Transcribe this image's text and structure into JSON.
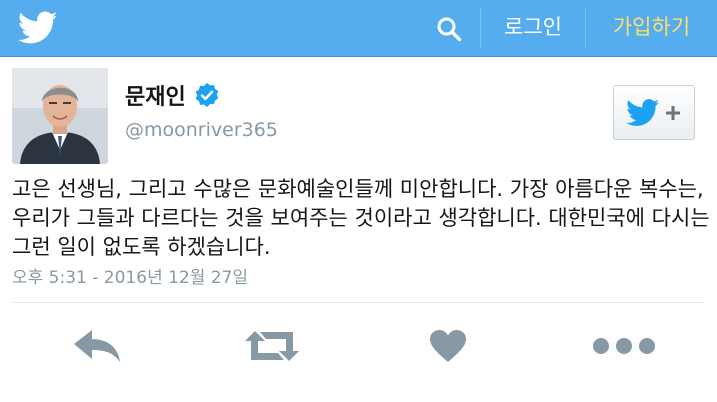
{
  "header": {
    "search_icon": "search-icon",
    "login_label": "로그인",
    "signup_label": "가입하기",
    "colors": {
      "bar": "#55acee",
      "signup": "#ffe066"
    }
  },
  "tweet": {
    "author_name": "문재인",
    "handle": "@moonriver365",
    "verified": true,
    "text": "고은 선생님, 그리고 수많은 문화예술인들께 미안합니다. 가장 아름다운 복수는, 우리가 그들과 다르다는 것을 보여주는 것이라고 생각합니다. 대한민국에 다시는 그런 일이 없도록 하겠습니다.",
    "timestamp": "오후 5:31 - 2016년 12월 27일"
  },
  "actions": [
    "reply-icon",
    "retweet-icon",
    "like-icon",
    "more-icon"
  ]
}
